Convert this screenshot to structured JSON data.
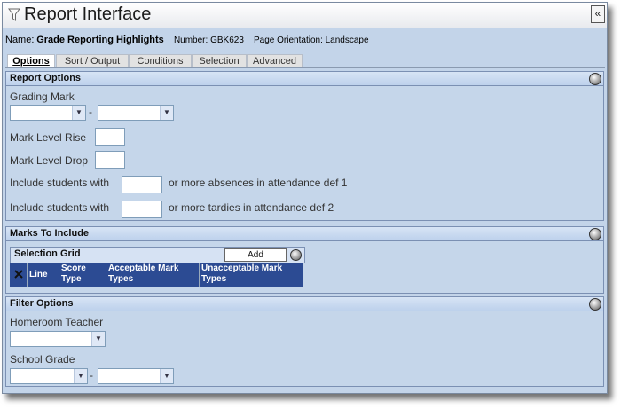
{
  "window": {
    "title": "Report Interface"
  },
  "header": {
    "name_label": "Name:",
    "name_value": "Grade Reporting Highlights",
    "number_label": "Number:",
    "number_value": "GBK623",
    "orientation_label": "Page Orientation:",
    "orientation_value": "Landscape"
  },
  "tabs": [
    {
      "label": "Options",
      "active": true
    },
    {
      "label": "Sort / Output",
      "active": false
    },
    {
      "label": "Conditions",
      "active": false
    },
    {
      "label": "Selection",
      "active": false
    },
    {
      "label": "Advanced",
      "active": false
    }
  ],
  "report_options": {
    "title": "Report Options",
    "grading_mark_label": "Grading Mark",
    "range_separator": "-",
    "mark_level_rise_label": "Mark Level Rise",
    "mark_level_drop_label": "Mark Level Drop",
    "absences_prefix": "Include students with",
    "absences_suffix": "or more absences in attendance def 1",
    "tardies_prefix": "Include students with",
    "tardies_suffix": "or more tardies in attendance def 2"
  },
  "marks_to_include": {
    "title": "Marks To Include",
    "grid_title": "Selection Grid",
    "add_label": "Add",
    "columns": [
      "Line",
      "Score Type",
      "Acceptable Mark Types",
      "Unacceptable Mark Types"
    ]
  },
  "filter_options": {
    "title": "Filter Options",
    "homeroom_label": "Homeroom Teacher",
    "school_grade_label": "School Grade",
    "range_separator": "-"
  },
  "icons": {
    "window": "funnel-icon",
    "collapse": "double-chevron-left-icon",
    "section": "expand-circle-icon",
    "grid_delete": "x-icon"
  },
  "colors": {
    "panel": "#c3d4e9",
    "grid_header": "#2c4b93"
  }
}
